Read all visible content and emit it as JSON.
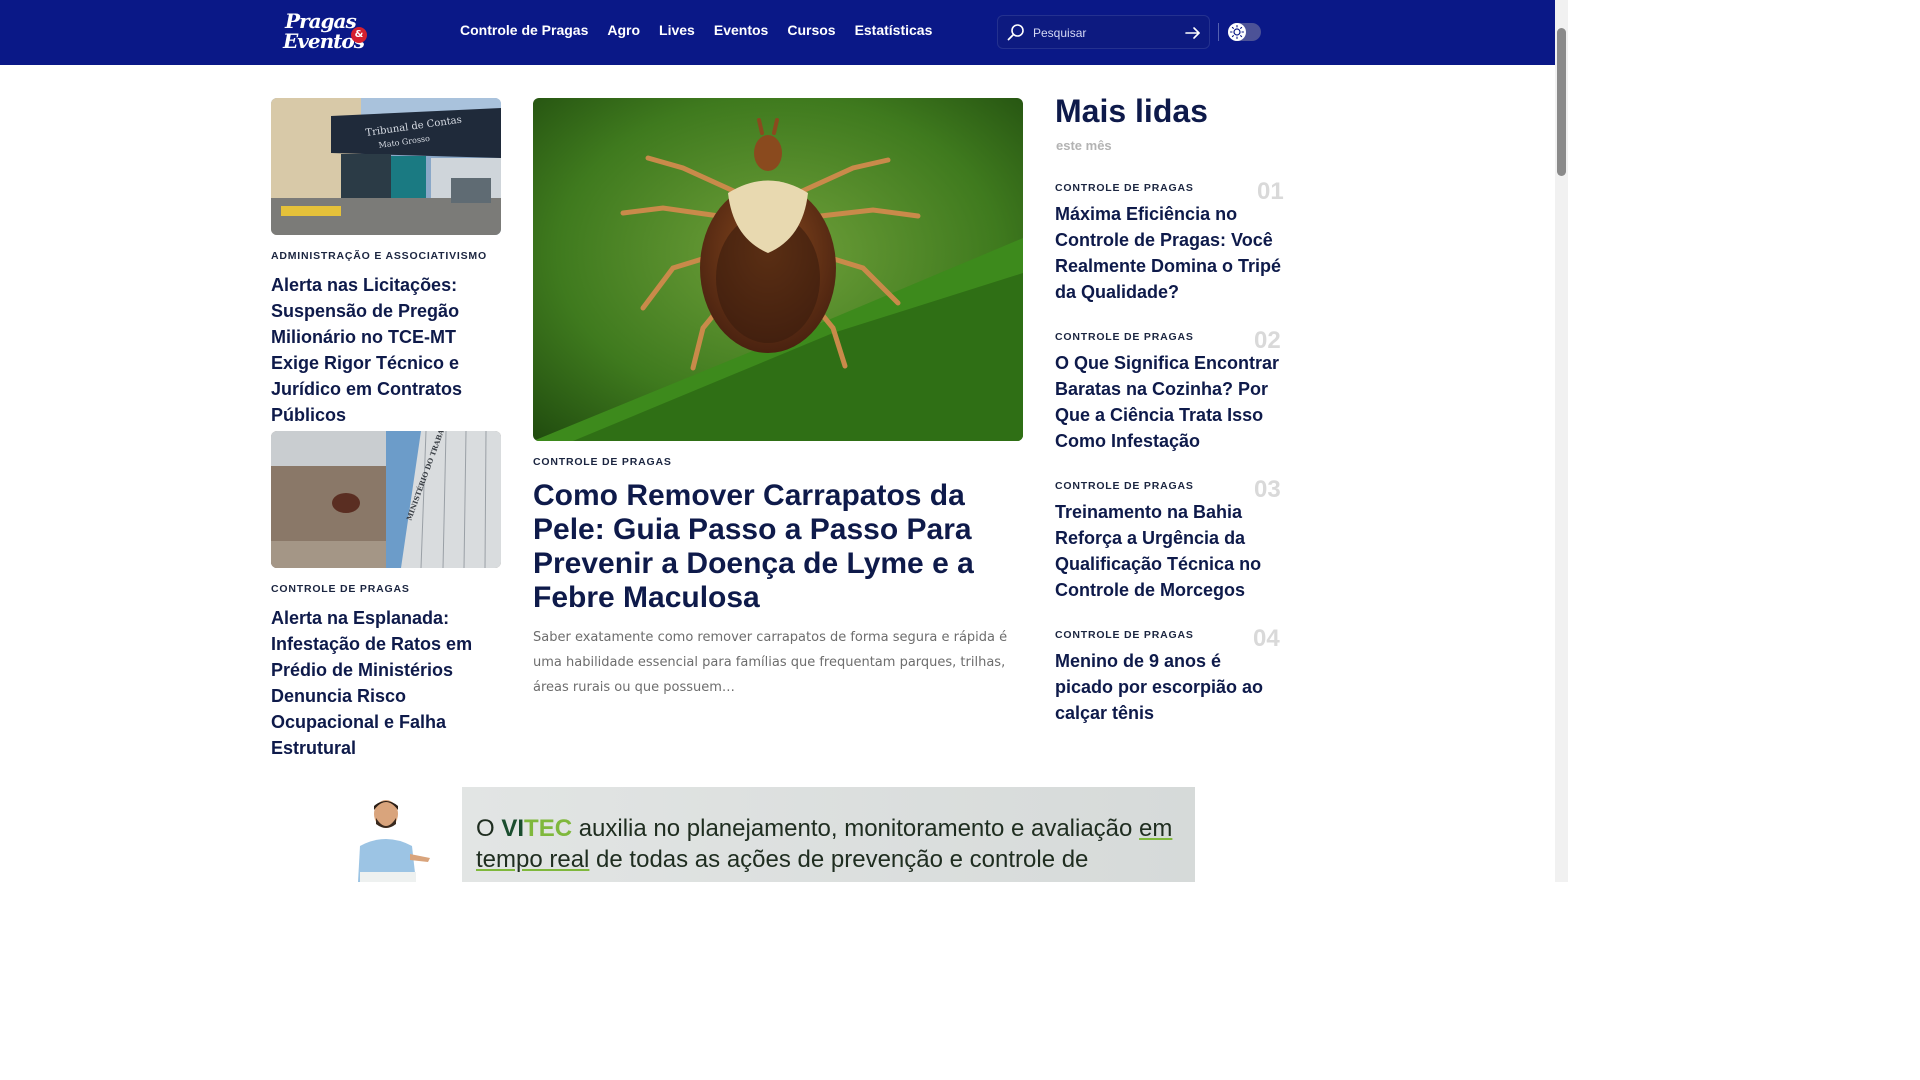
{
  "header": {
    "logo_line1": "Pragas",
    "logo_line2": "Eventos",
    "logo_amp": "&",
    "nav": [
      "Controle de Pragas",
      "Agro",
      "Lives",
      "Eventos",
      "Cursos",
      "Estatísticas"
    ],
    "search_placeholder": "Pesquisar",
    "icons": {
      "search": "search-icon",
      "submit": "arrow-right-icon",
      "theme": "sun-icon"
    }
  },
  "left_articles": [
    {
      "category": "Administração e Associativismo",
      "title": "Alerta nas Licitações: Suspensão de Pregão Milionário no TCE-MT Exige Rigor Técnico e Jurídico em Contratos Públicos"
    },
    {
      "category": "Controle de Pragas",
      "title": "Alerta na Esplanada: Infestação de Ratos em Prédio de Ministérios Denuncia Risco Ocupacional e Falha Estrutural"
    }
  ],
  "featured": {
    "category": "Controle de Pragas",
    "title": "Como Remover Carrapatos da Pele: Guia Passo a Passo Para Prevenir a Doença de Lyme e a Febre Maculosa",
    "excerpt": "Saber exatamente como remover carrapatos de forma segura e rápida é uma habilidade essencial para famílias que frequentam parques, trilhas, áreas rurais ou que possuem…"
  },
  "sidebar": {
    "heading": "Mais lidas",
    "subheading": "este mês",
    "items": [
      {
        "rank": "01",
        "category": "Controle de Pragas",
        "title": "Máxima Eficiência no Controle de Pragas: Você Realmente Domina o Tripé da Qualidade?"
      },
      {
        "rank": "02",
        "category": "Controle de Pragas",
        "title": "O Que Significa Encontrar Baratas na Cozinha? Por Que a Ciência Trata Isso Como Infestação"
      },
      {
        "rank": "03",
        "category": "Controle de Pragas",
        "title": "Treinamento na Bahia Reforça a Urgência da Qualificação Técnica no Controle de Morcegos"
      },
      {
        "rank": "04",
        "category": "Controle de Pragas",
        "title": "Menino de 9 anos é picado por escorpião ao calçar tênis"
      }
    ]
  },
  "banner": {
    "t1": "O ",
    "brand1": "VI",
    "brand2": "TEC",
    "t2": " auxilia no planejamento, monitoramento e avaliação ",
    "t3": "em tempo real",
    "t4": " de todas as ações de prevenção e controle de"
  }
}
